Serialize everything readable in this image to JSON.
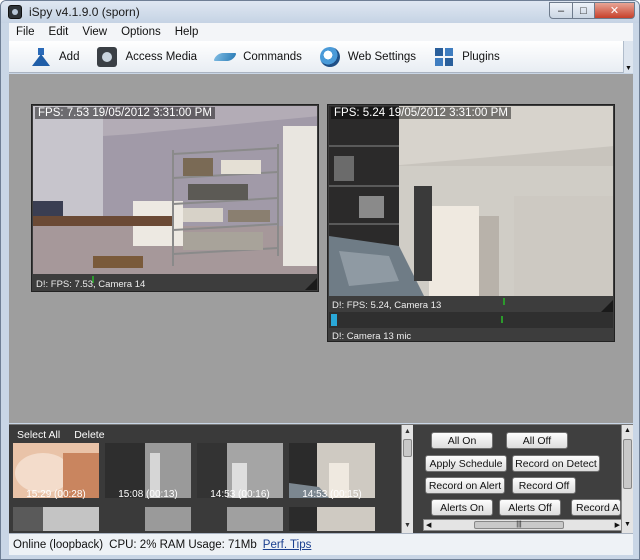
{
  "window": {
    "title": "iSpy v4.1.9.0 (sporn)"
  },
  "menu": [
    "File",
    "Edit",
    "View",
    "Options",
    "Help"
  ],
  "toolbar": [
    {
      "label": "Add",
      "icon": "flask-icon"
    },
    {
      "label": "Access Media",
      "icon": "media-icon"
    },
    {
      "label": "Commands",
      "icon": "commands-icon"
    },
    {
      "label": "Web Settings",
      "icon": "web-icon"
    },
    {
      "label": "Plugins",
      "icon": "plugin-icon"
    }
  ],
  "cameras": [
    {
      "overlay": "FPS: 7.53 19/05/2012 3:31:00 PM",
      "footer": "D!: FPS: 7.53, Camera 14"
    },
    {
      "overlay": "FPS: 5.24 19/05/2012 3:31:00 PM",
      "footer": "D!: FPS: 5.24, Camera 13",
      "mic": "D!: Camera 13 mic",
      "mic_level": 0.02
    }
  ],
  "media": {
    "select_all": "Select All",
    "delete": "Delete",
    "thumbnails": [
      "15:29 (00:28)",
      "15:08 (00:13)",
      "14:53 (00:16)",
      "14:53 (00:15)"
    ]
  },
  "controls": {
    "all_on": "All On",
    "all_off": "All Off",
    "apply_schedule": "Apply Schedule",
    "record_on_detect": "Record on Detect",
    "record_on_alert": "Record on Alert",
    "record_off": "Record Off",
    "alerts_on": "Alerts On",
    "alerts_off": "Alerts Off",
    "record_all": "Record All"
  },
  "status": {
    "connection": "Online (loopback)",
    "usage": "CPU: 2% RAM Usage: 71Mb",
    "perf_tips": "Perf. Tips"
  },
  "colors": {
    "frame": "#c9d6e6",
    "video_bg": "#3d3d3d",
    "activity": "#2c9a2c",
    "mic_level": "#2aa8d8"
  }
}
